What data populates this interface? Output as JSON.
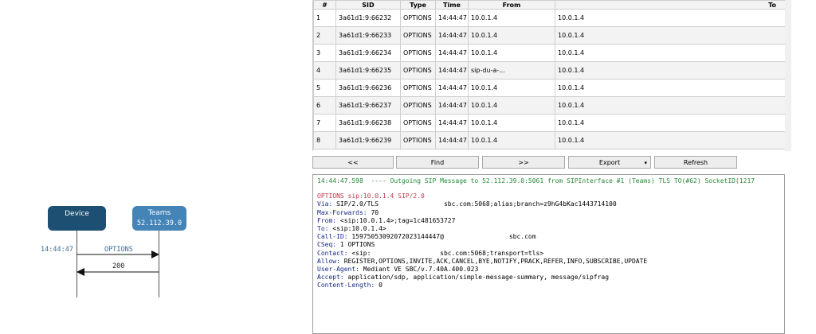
{
  "diagram": {
    "device_label": "Device",
    "teams_label": "Teams",
    "teams_ip": "52.112.39.0",
    "timestamp": "14:44:47",
    "msg1": "OPTIONS",
    "msg2": "200"
  },
  "table": {
    "headers": [
      "#",
      "SID",
      "Type",
      "Time",
      "From",
      "To"
    ],
    "rows": [
      [
        "1",
        "3a61d1:9:66232",
        "OPTIONS",
        "14:44:47",
        "10.0.1.4",
        "10.0.1.4"
      ],
      [
        "2",
        "3a61d1:9:66233",
        "OPTIONS",
        "14:44:47",
        "10.0.1.4",
        "10.0.1.4"
      ],
      [
        "3",
        "3a61d1:9:66234",
        "OPTIONS",
        "14:44:47",
        "10.0.1.4",
        "10.0.1.4"
      ],
      [
        "4",
        "3a61d1:9:66235",
        "OPTIONS",
        "14:44:47",
        "sip-du-a-...",
        "10.0.1.4"
      ],
      [
        "5",
        "3a61d1:9:66236",
        "OPTIONS",
        "14:44:47",
        "10.0.1.4",
        "10.0.1.4"
      ],
      [
        "6",
        "3a61d1:9:66237",
        "OPTIONS",
        "14:44:47",
        "10.0.1.4",
        "10.0.1.4"
      ],
      [
        "7",
        "3a61d1:9:66238",
        "OPTIONS",
        "14:44:47",
        "10.0.1.4",
        "10.0.1.4"
      ],
      [
        "8",
        "3a61d1:9:66239",
        "OPTIONS",
        "14:44:47",
        "10.0.1.4",
        "10.0.1.4"
      ]
    ]
  },
  "toolbar": {
    "prev": "<<",
    "find": "Find",
    "next": ">>",
    "export": "Export",
    "refresh": "Refresh"
  },
  "log": {
    "header": "14:44:47.598  ---- Outgoing SIP Message to 52.112.39.0:5061 from SIPInterface #1 (Teams) TLS TO(#62) SocketID(1217",
    "request_line": "OPTIONS sip:10.0.1.4 SIP/2.0",
    "lines": [
      {
        "key": "Via:",
        "val": " SIP/2.0/TLS                 sbc.com:5068;alias;branch=z9hG4bKac1443714100"
      },
      {
        "key": "Max-Forwards:",
        "val": " 70"
      },
      {
        "key": "From:",
        "val": " <sip:10.0.1.4>;tag=1c481653727"
      },
      {
        "key": "To:",
        "val": " <sip:10.0.1.4>"
      },
      {
        "key": "Call-ID:",
        "val": " 15975053092072023144447@                 sbc.com"
      },
      {
        "key": "CSeq:",
        "val": " 1 OPTIONS"
      },
      {
        "key": "Contact:",
        "val": " <sip:                  sbc.com:5068;transport=tls>"
      },
      {
        "key": "Allow:",
        "val": " REGISTER,OPTIONS,INVITE,ACK,CANCEL,BYE,NOTIFY,PRACK,REFER,INFO,SUBSCRIBE,UPDATE"
      },
      {
        "key": "User-Agent:",
        "val": " Mediant VE SBC/v.7.40A.400.023"
      },
      {
        "key": "Accept:",
        "val": " application/sdp, application/simple-message-summary, message/sipfrag"
      },
      {
        "key": "Content-Length:",
        "val": " 0"
      }
    ]
  }
}
